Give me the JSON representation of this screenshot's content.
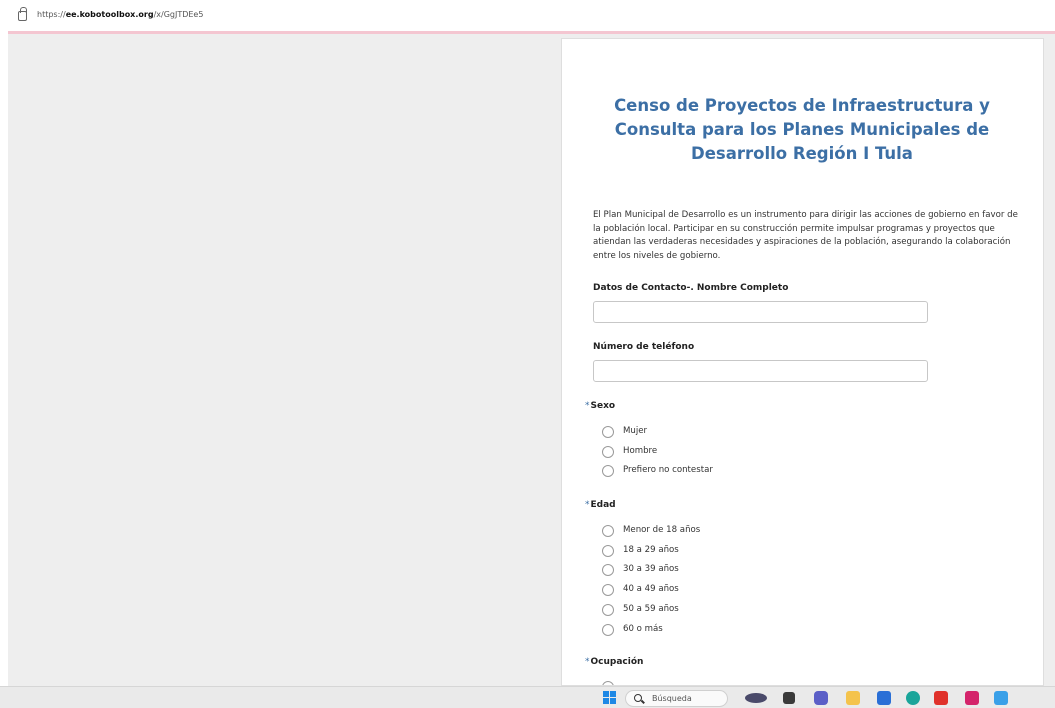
{
  "browser": {
    "url_prefix": "https://",
    "url_domain": "ee.kobotoolbox.org",
    "url_path": "/x/GgJTDEe5"
  },
  "form": {
    "title": "Censo de Proyectos de Infraestructura y Consulta para los Planes Municipales de Desarrollo Región I Tula",
    "intro": "El Plan Municipal de Desarrollo es un instrumento para dirigir las acciones de gobierno en favor de la población local. Participar en su construcción permite impulsar programas y proyectos que atiendan las verdaderas necesidades y aspiraciones de la población, asegurando la colaboración entre los niveles de gobierno.",
    "required_marker": "*",
    "questions": {
      "nombre": {
        "label": "Datos de Contacto-. Nombre Completo",
        "value": ""
      },
      "telefono": {
        "label": "Número de teléfono",
        "value": ""
      },
      "sexo": {
        "label": "Sexo",
        "options": [
          "Mujer",
          "Hombre",
          "Prefiero no contestar"
        ]
      },
      "edad": {
        "label": "Edad",
        "options": [
          "Menor de 18 años",
          "18 a 29 años",
          "30 a 39 años",
          "40 a 49 años",
          "50 a 59 años",
          "60 o más"
        ]
      },
      "ocupacion": {
        "label": "Ocupación"
      }
    }
  },
  "taskbar": {
    "search_text": "Búsqueda",
    "icons": [
      "windows-start-icon",
      "search-icon",
      "eye-app-icon",
      "file-viewer-icon",
      "teams-icon",
      "file-explorer-icon",
      "microsoft-store-icon",
      "edge-icon",
      "acrobat-icon",
      "indesign-icon",
      "photos-icon"
    ]
  }
}
